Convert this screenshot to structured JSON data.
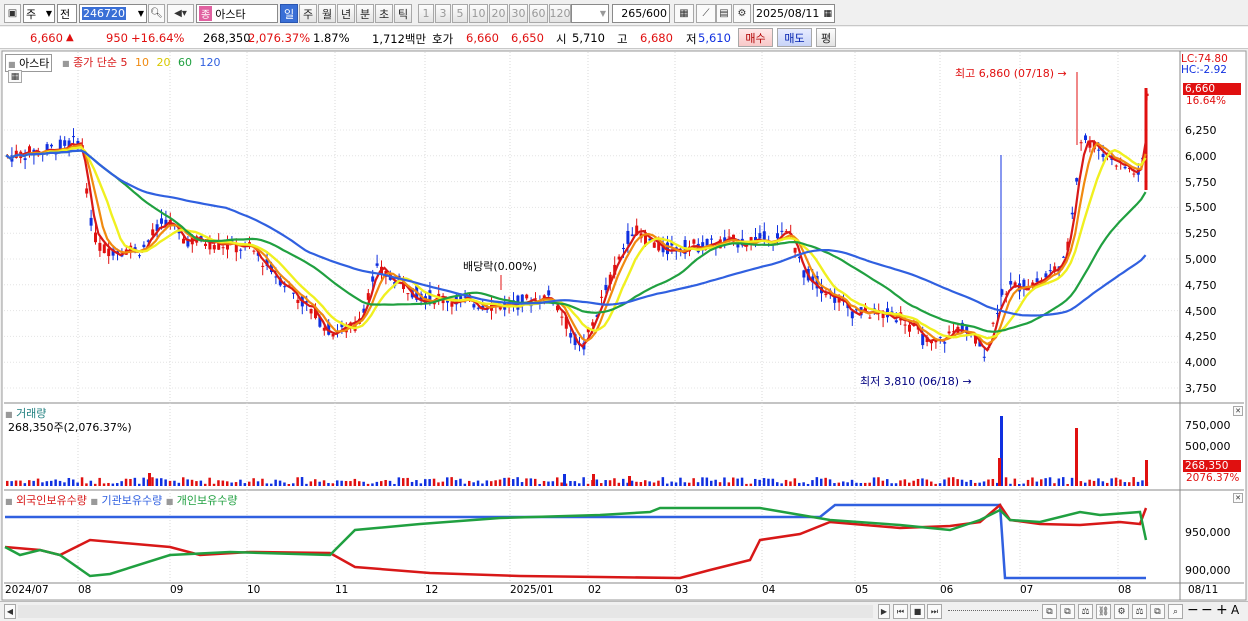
{
  "toolbar": {
    "period_mode": "주",
    "prev_label": "전",
    "stock_code": "246720",
    "stock_type_badge": "종",
    "stock_name": "아스타",
    "interval_buttons": [
      "일",
      "주",
      "월",
      "년",
      "분",
      "초",
      "틱"
    ],
    "interval_active": "일",
    "minute_buttons": [
      "1",
      "3",
      "5",
      "10",
      "20",
      "30",
      "60",
      "120"
    ],
    "count_display": "265",
    "count_total": "/600",
    "date_value": "2025/08/11"
  },
  "quote": {
    "price": "6,660",
    "change": "950",
    "change_pct": "+16.64%",
    "volume": "268,350",
    "volume_pct": "2,076.37%",
    "turnover_pct": "1.87%",
    "amount": "1,712백만",
    "ask_label": "호가",
    "ask": "6,660",
    "bid": "6,650",
    "open_label": "시",
    "open": "5,710",
    "high_label": "고",
    "high": "6,680",
    "low_label": "저",
    "low": "5,610",
    "buy_label": "매수",
    "sell_label": "매도",
    "flat_label": "평"
  },
  "price_pane": {
    "stock_label": "아스타",
    "ma_title": "종가 단순",
    "ma_periods": [
      "5",
      "10",
      "20",
      "60",
      "120"
    ],
    "lc_label": "LC:74.80",
    "hc_label": "HC:-2.92",
    "last_price_tag": "6,660",
    "last_pct_tag": "16.64%",
    "high_note": "최고 6,860 (07/18)",
    "low_note": "최저 3,810 (06/18)",
    "ex_dividend_note": "배당락(0.00%)",
    "y_ticks": [
      "6,250",
      "6,000",
      "5,750",
      "5,500",
      "5,250",
      "5,000",
      "4,750",
      "4,500",
      "4,250",
      "4,000",
      "3,750"
    ]
  },
  "volume_pane": {
    "title": "거래량",
    "summary": "268,350주(2,076.37%)",
    "y_ticks": [
      "750,000",
      "500,000"
    ],
    "last_tag": "268,350",
    "last_pct_tag": "2076.37%"
  },
  "holdings_pane": {
    "series": [
      "외국인보유수량",
      "기관보유수량",
      "개인보유수량"
    ],
    "y_ticks": [
      "950,000",
      "900,000"
    ]
  },
  "x_axis": {
    "labels": [
      "2024/07",
      "08",
      "09",
      "10",
      "11",
      "12",
      "2025/01",
      "02",
      "03",
      "04",
      "05",
      "06",
      "07",
      "08",
      "08/11"
    ]
  },
  "colors": {
    "up": "#e01010",
    "down": "#1030e0",
    "ma5": "#d81818",
    "ma10": "#f08a10",
    "ma20": "#f0f020",
    "ma60": "#20a040",
    "ma120": "#3060e0"
  }
}
